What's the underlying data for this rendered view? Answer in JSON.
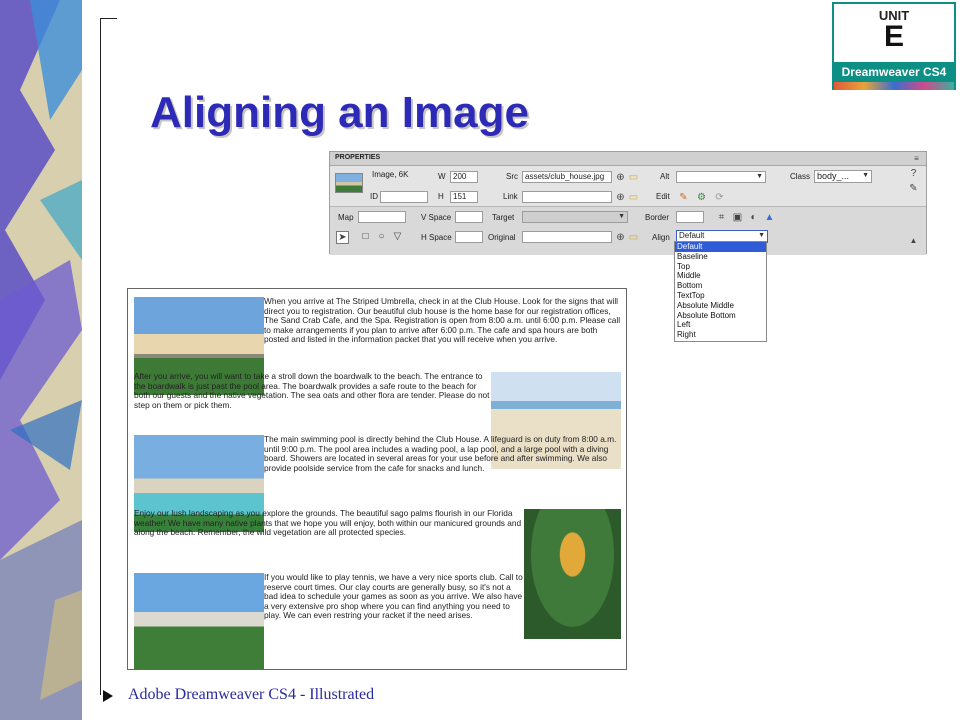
{
  "slide": {
    "title": "Aligning an Image",
    "footer": "Adobe Dreamweaver CS4 - Illustrated",
    "accent_color": "#2e2ab8"
  },
  "badge": {
    "unit_label": "UNIT",
    "unit_letter": "E",
    "product": "Dreamweaver CS4",
    "color": "#0d8f86"
  },
  "properties": {
    "header": "PROPERTIES",
    "image_info": "Image, 6K",
    "labels": {
      "w": "W",
      "h": "H",
      "id": "ID",
      "src": "Src",
      "link": "Link",
      "alt": "Alt",
      "edit": "Edit",
      "class": "Class",
      "map": "Map",
      "v_space": "V Space",
      "h_space": "H Space",
      "target": "Target",
      "original": "Original",
      "border": "Border",
      "align": "Align"
    },
    "values": {
      "w": "200",
      "h": "151",
      "src": "assets/club_house.jpg",
      "class": "body_...",
      "align": "Default"
    },
    "align_options": [
      "Default",
      "Baseline",
      "Top",
      "Middle",
      "Bottom",
      "TextTop",
      "Absolute Middle",
      "Absolute Bottom",
      "Left",
      "Right"
    ]
  },
  "document": {
    "paragraphs": [
      "When you arrive at The Striped Umbrella, check in at the Club House. Look for the signs that will direct you to registration. Our beautiful club house is the home base for our registration offices, The Sand Crab Cafe, and the Spa. Registration is open from 8:00 a.m. until 6:00 p.m. Please call to make arrangements if you plan to arrive after 6:00 p.m. The cafe and spa hours are both posted and listed in the information packet that you will receive when you arrive.",
      "After you arrive, you will want to take a stroll down the boardwalk to the beach. The entrance to the boardwalk is just past the pool area. The boardwalk provides a safe route to the beach for both our guests and the native vegetation. The sea oats and other flora are tender. Please do not step on them or pick them.",
      "The main swimming pool is directly behind the Club House. A lifeguard is on duty from 8:00 a.m. until 9:00 p.m. The pool area includes a wading pool, a lap pool, and a large pool with a diving board. Showers are located in several areas for your use before and after swimming. We also provide poolside service from the cafe for snacks and lunch.",
      "Enjoy our lush landscaping as you explore the grounds. The beautiful sago palms flourish in our Florida weather! We have many native plants that we hope you will enjoy, both within our manicured grounds and along the beach. Remember, the wild vegetation are all protected species.",
      "If you would like to play tennis, we have a very nice sports club. Call to reserve court times. Our clay courts are generally busy, so it's not a bad idea to schedule your games as soon as you arrive. We also have a very extensive pro shop where you can find anything you need to play. We can even restring your racket if the need arises."
    ]
  }
}
